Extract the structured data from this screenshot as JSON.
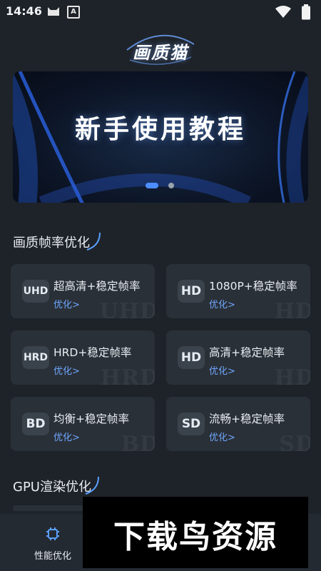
{
  "status_bar": {
    "time": "14:46",
    "notification_a": "A"
  },
  "header": {
    "app_title": "画质猫"
  },
  "banner": {
    "text": "新手使用教程",
    "page_count": 2,
    "active_index": 0
  },
  "sections": {
    "frame_rate": {
      "title": "画质帧率优化"
    },
    "gpu": {
      "title": "GPU渲染优化"
    }
  },
  "cards": [
    {
      "badge": "UHD",
      "title": "超高清+稳定帧率",
      "action": "优化>",
      "watermark": "UHD"
    },
    {
      "badge": "HD",
      "title": "1080P+稳定帧率",
      "action": "优化>",
      "watermark": "HD"
    },
    {
      "badge": "HRD",
      "title": "HRD+稳定帧率",
      "action": "优化>",
      "watermark": "HRD"
    },
    {
      "badge": "HD",
      "title": "高清+稳定帧率",
      "action": "优化>",
      "watermark": "HD"
    },
    {
      "badge": "BD",
      "title": "均衡+稳定帧率",
      "action": "优化>",
      "watermark": "BD"
    },
    {
      "badge": "SD",
      "title": "流畅+稳定帧率",
      "action": "优化>",
      "watermark": "SD"
    }
  ],
  "bottom_nav": {
    "items": [
      {
        "label": "性能优化",
        "icon": "chip-icon",
        "active": true
      }
    ]
  },
  "overlay_watermark": {
    "text": "下载鸟资源"
  },
  "colors": {
    "background": "#1e2329",
    "card": "#2a3037",
    "accent": "#6ea6ff",
    "dot_active": "#4d8dff"
  }
}
